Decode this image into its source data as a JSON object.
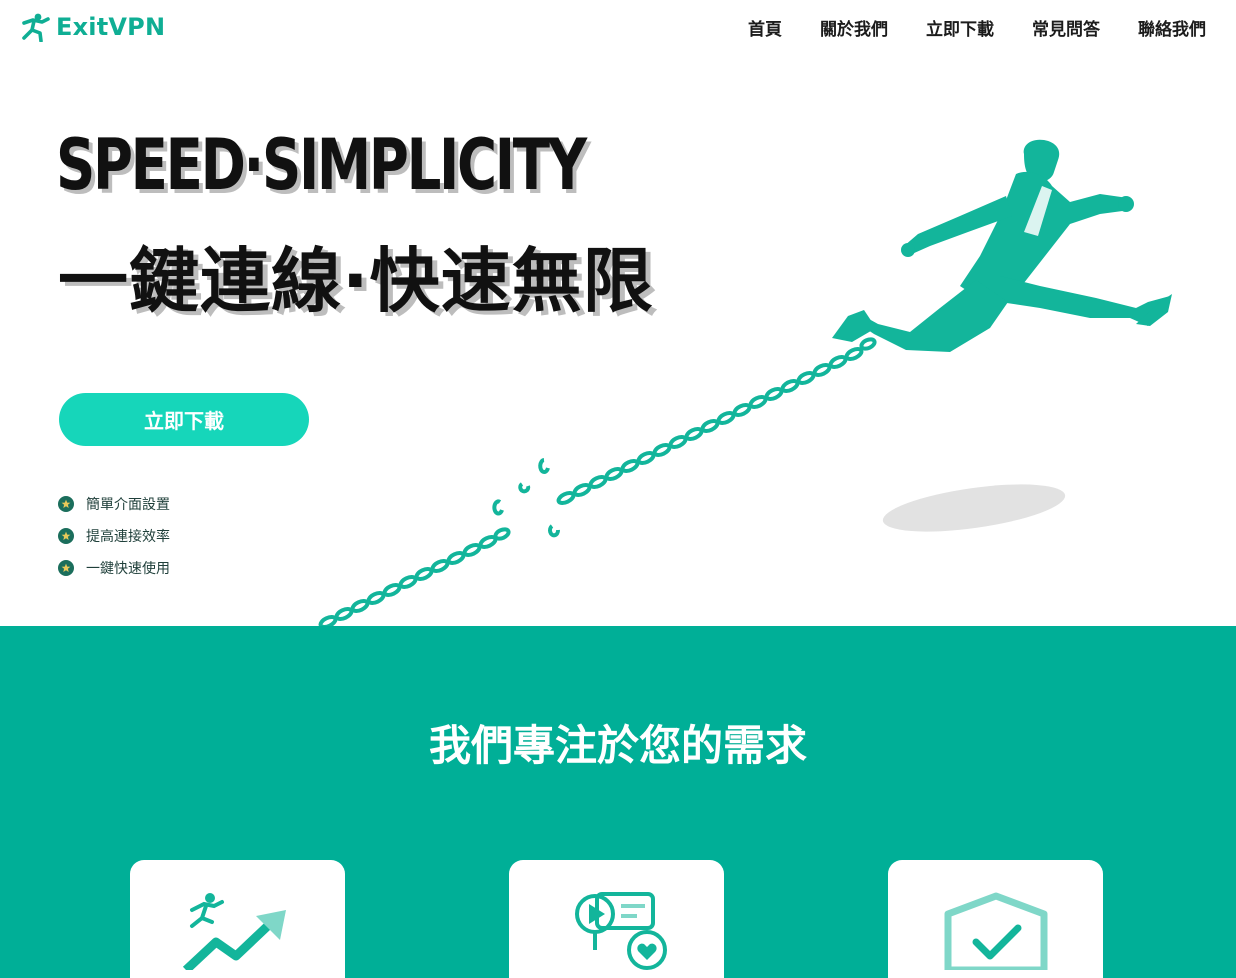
{
  "brand": {
    "name": "ExitVPN",
    "accent_color": "#0fae94",
    "logo_icon": "running-man-icon"
  },
  "nav": {
    "items": [
      "首頁",
      "關於我們",
      "立即下載",
      "常見問答",
      "聯絡我們"
    ]
  },
  "hero": {
    "headline_en": "SPEED·SIMPLICITY",
    "headline_zh": "一鍵連線·快速無限",
    "cta_label": "立即下載",
    "cta_color": "#16d6ba",
    "features": [
      "簡單介面設置",
      "提高連接效率",
      "一鍵快速使用"
    ],
    "feature_icon": "star-badge-icon",
    "illustration": "man-breaking-chain-illustration"
  },
  "section2": {
    "title": "我們專注於您的需求",
    "background": "#00af97",
    "cards": [
      {
        "icon": "growth-chart-icon"
      },
      {
        "icon": "media-devices-icon"
      },
      {
        "icon": "shield-check-icon"
      }
    ]
  }
}
